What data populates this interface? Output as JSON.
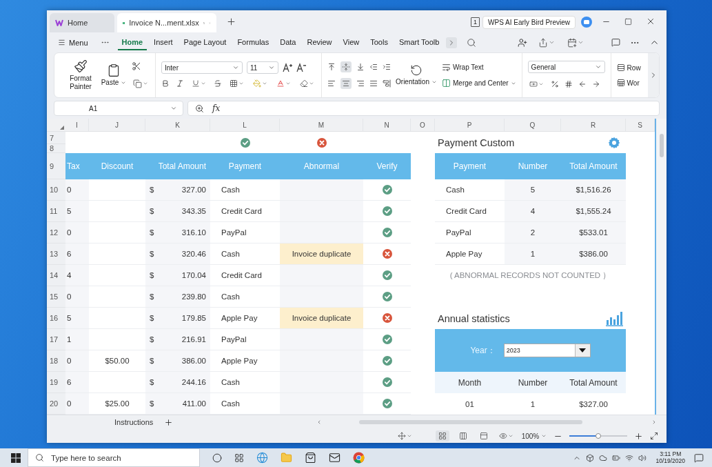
{
  "window": {
    "tabs": [
      {
        "label": "Home",
        "kind": "home",
        "selected": false
      },
      {
        "label": "Invoice N...ment.xlsx",
        "kind": "file",
        "selected": true
      }
    ],
    "window_count": "1",
    "ai_button": "WPS AI Early Bird Preview"
  },
  "menu": {
    "label": "Menu",
    "tabs": [
      {
        "label": "Home",
        "selected": true
      },
      {
        "label": "Insert",
        "selected": false
      },
      {
        "label": "Page Layout",
        "selected": false
      },
      {
        "label": "Formulas",
        "selected": false
      },
      {
        "label": "Data",
        "selected": false
      },
      {
        "label": "Review",
        "selected": false
      },
      {
        "label": "View",
        "selected": false
      },
      {
        "label": "Tools",
        "selected": false
      },
      {
        "label": "Smart Toolb",
        "selected": false
      }
    ]
  },
  "ribbon": {
    "format_painter": "Format Painter",
    "paste": "Paste",
    "font": "Inter",
    "font_size": "11",
    "orientation": "Orientation",
    "wrap_text": "Wrap Text",
    "merge": "Merge and Center",
    "number_format": "General",
    "rows": "Row",
    "worksheet": "Wor"
  },
  "formula_bar": {
    "name_box": "A1",
    "fx": "fx"
  },
  "sheet": {
    "columns": [
      "I",
      "J",
      "K",
      "L",
      "M",
      "N",
      "O",
      "P",
      "Q",
      "R",
      "S"
    ],
    "row_numbers": [
      "7",
      "8",
      "9",
      "10",
      "11",
      "12",
      "13",
      "14",
      "15",
      "16",
      "17",
      "18",
      "19",
      "20"
    ],
    "legend": [
      {
        "kind": "ok"
      },
      {
        "kind": "error"
      }
    ],
    "invoice_table": {
      "columns": [
        "Tax",
        "Discount",
        "Total Amount",
        "Payment",
        "Abnormal",
        "Verify"
      ],
      "rows": [
        {
          "tax": "0",
          "currency": "$",
          "amount": "327.00",
          "payment": "Cash",
          "verified": true
        },
        {
          "tax": "5",
          "currency": "$",
          "amount": "343.35",
          "payment": "Credit Card",
          "verified": true
        },
        {
          "tax": "0",
          "currency": "$",
          "amount": "316.10",
          "payment": "PayPal",
          "verified": true
        },
        {
          "tax": "6",
          "currency": "$",
          "amount": "320.46",
          "payment": "Cash",
          "abnormal": "Invoice duplicate",
          "verified": false
        },
        {
          "tax": "4",
          "currency": "$",
          "amount": "170.04",
          "payment": "Credit Card",
          "verified": true
        },
        {
          "tax": "0",
          "currency": "$",
          "amount": "239.80",
          "payment": "Cash",
          "verified": true
        },
        {
          "tax": "5",
          "currency": "$",
          "amount": "179.85",
          "payment": "Apple Pay",
          "abnormal": "Invoice duplicate",
          "verified": false
        },
        {
          "tax": "1",
          "currency": "$",
          "amount": "216.91",
          "payment": "PayPal",
          "verified": true
        },
        {
          "tax": "0",
          "discount": "$50.00",
          "currency": "$",
          "amount": "386.00",
          "payment": "Apple Pay",
          "verified": true
        },
        {
          "tax": "6",
          "currency": "$",
          "amount": "244.16",
          "payment": "Cash",
          "verified": true
        },
        {
          "tax": "0",
          "discount": "$25.00",
          "currency": "$",
          "amount": "411.00",
          "payment": "Cash",
          "verified": true
        }
      ]
    },
    "payment_summary": {
      "title": "Payment Custom",
      "columns": [
        "Payment",
        "Number",
        "Total Amount"
      ],
      "rows": [
        {
          "payment": "Cash",
          "number": "5",
          "total": "$1,516.26"
        },
        {
          "payment": "Credit Card",
          "number": "4",
          "total": "$1,555.24"
        },
        {
          "payment": "PayPal",
          "number": "2",
          "total": "$533.01"
        },
        {
          "payment": "Apple Pay",
          "number": "1",
          "total": "$386.00"
        }
      ],
      "note": "( ABNORMAL RECORDS NOT COUNTED ）"
    },
    "annual_statistics": {
      "title": "Annual statistics",
      "year_label": "Year：",
      "year": "2023",
      "columns": [
        "Month",
        "Number",
        "Total Amount"
      ],
      "rows": [
        {
          "month": "01",
          "number": "1",
          "total": "$327.00"
        }
      ]
    }
  },
  "sheet_tabs": [
    {
      "label": "Instructions",
      "selected": false
    }
  ],
  "status_bar": {
    "zoom": "100%",
    "zoom_slider": {
      "level": 0.5
    },
    "views": [
      {
        "selected": true
      },
      {
        "selected": false
      },
      {
        "selected": false
      }
    ]
  },
  "taskbar": {
    "search_placeholder": "Type here to search",
    "time": "3:11 PM",
    "date": "10/19/2020"
  }
}
